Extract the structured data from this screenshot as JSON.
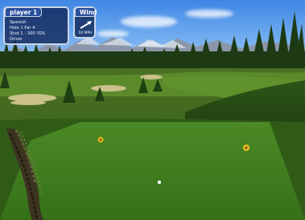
{
  "hud": {
    "player_panel": {
      "title": "player 1",
      "lines": [
        "Spanish",
        "Hole 1 Par 4",
        "Shot 1 - 300 YDS",
        "Driver"
      ]
    },
    "wind_panel": {
      "title": "Wind",
      "speed": "10 MPH",
      "icon": "wind-arrow-icon"
    }
  },
  "scene": {
    "description_icon": "golf-tee-box",
    "colors": {
      "sky": "#5b9ae8",
      "fairway": "#4f7a22",
      "tee_box": "#3e7a1f",
      "rough": "#2d5a16",
      "hud_panel": "#12285c",
      "tee_marker": "#e0b21a"
    }
  }
}
